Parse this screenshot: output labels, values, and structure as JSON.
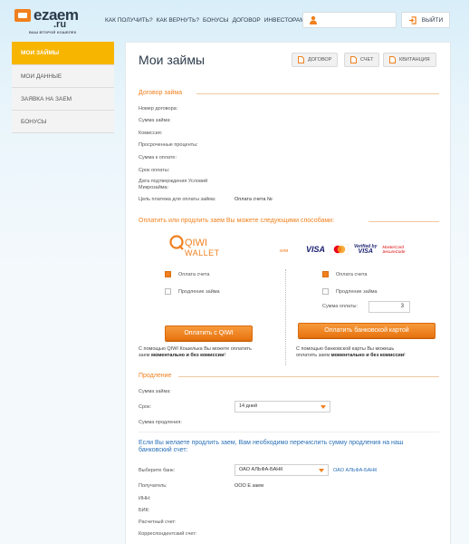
{
  "header": {
    "logo": "ezaem",
    "logo_ru": ".ru",
    "tagline": "ВАШ ВТОРОЙ КОШЕЛЕК",
    "nav": [
      "КАК ПОЛУЧИТЬ?",
      "КАК ВЕРНУТЬ?",
      "БОНУСЫ",
      "ДОГОВОР",
      "ИНВЕСТОРАМ"
    ],
    "logout": "ВЫЙТИ"
  },
  "sidebar": {
    "items": [
      {
        "label": "МОИ ЗАЙМЫ"
      },
      {
        "label": "МОИ ДАННЫЕ"
      },
      {
        "label": "ЗАЯВКА НА ЗАЕМ"
      },
      {
        "label": "БОНУСЫ"
      }
    ]
  },
  "main": {
    "title": "Мои займы",
    "tabs": [
      "ДОГОВОР",
      "СЧЕТ",
      "КВИТАНЦИЯ"
    ],
    "contract": {
      "heading": "Договор займа",
      "fields": [
        "Номер договора:",
        "Сумма займа:",
        "Комиссия:",
        "Просроченные проценты:",
        "Сумма к оплате:",
        "Срок оплаты:",
        "Дата подтверждения Условий Микрозайма:",
        "Цель платежа для оплаты займа:"
      ],
      "purpose_value": "Оплата счета №"
    },
    "pay": {
      "heading": "Оплатить или продлить заем Вы можете следующими способами:",
      "qiwi_line1": "QIWI",
      "qiwi_line2": "WALLET",
      "or": "или",
      "visa": "VISA",
      "vbv_line1": "Verified by",
      "vbv_line2": "VISA",
      "mcsc_line1": "MasterCard",
      "mcsc_line2": "SecureCode",
      "opt_pay": "Оплата счета",
      "opt_extend": "Продление займа",
      "sum_label": "Сумма оплаты:",
      "sum_value": "3",
      "qiwi_button": "Оплатить с QIWI",
      "card_button": "Оплатить банковской картой",
      "qiwi_note_1": "С помощью QIWI Кошелька Вы можете оплатить",
      "qiwi_note_2": "заем ",
      "qiwi_note_bold": "моментально и без комиссии",
      "qiwi_note_end": "!",
      "card_note_1": "С помощью банковской карты Вы можешь",
      "card_note_2": "оплатить заем ",
      "card_note_bold": "моментально и без комиссии",
      "card_note_end": "!"
    },
    "extend": {
      "heading": "Продление",
      "sum_label": "Сумма займа:",
      "term_label": "Срок:",
      "term_value": "14 дней",
      "ext_sum_label": "Сумма продления:",
      "notice": "Если Вы желаете продлить заем, Вам необходимо перечислить сумму продления на наш банковский счет:",
      "bank_label": "Выберите банк:",
      "bank_value": "ОАО АЛЬФА-БАНК",
      "bank_link": "ОАО АЛЬФА-БАНК",
      "recipient_label": "Получатель:",
      "recipient_value": "ООО Е заем",
      "inn_label": "ИНН:",
      "bik_label": "БИК:",
      "account_label": "Расчетный счет:",
      "corr_label": "Корреспондентский счет:"
    }
  },
  "colors": {
    "accent": "#f0801e",
    "link": "#2a70b8",
    "active_tab": "#f7b500"
  }
}
